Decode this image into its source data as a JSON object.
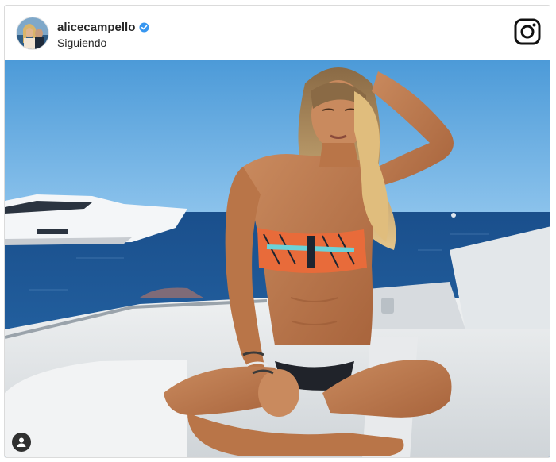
{
  "post": {
    "username": "alicecampello",
    "follow_status": "Siguiendo",
    "verified": true
  },
  "icons": {
    "verified": "verified-badge-icon",
    "brand": "instagram-logo-icon",
    "tag": "user-tag-icon"
  },
  "colors": {
    "sky": "#5fa7e0",
    "sea": "#1d5c9c",
    "verified_blue": "#3897f0",
    "text": "#262626"
  }
}
